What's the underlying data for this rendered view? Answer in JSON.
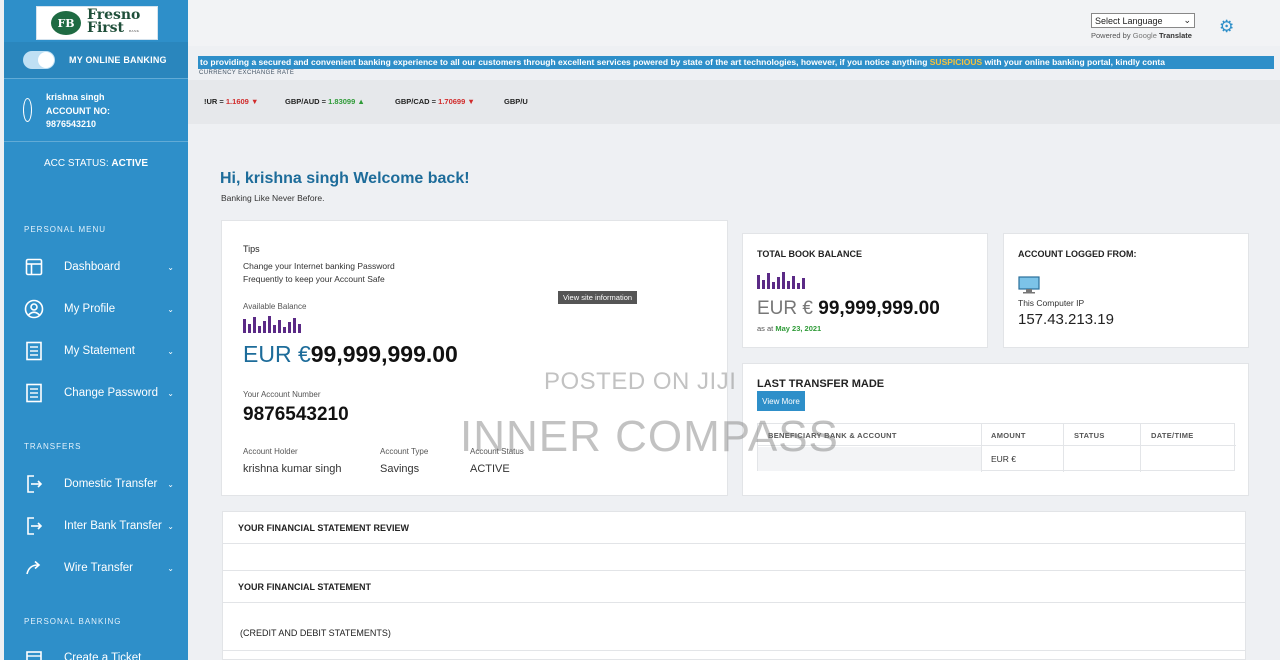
{
  "brand": {
    "logo_mark": "FB",
    "name_line1": "Fresno",
    "name_line2": "First",
    "name_tag": "BANK"
  },
  "sidebar": {
    "online_label": "MY ONLINE BANKING",
    "user_name": "krishna singh",
    "account_label": "ACCOUNT NO:",
    "account_number": "9876543210",
    "status_label": "ACC STATUS:",
    "status_value": "ACTIVE",
    "personal_menu_label": "PERSONAL MENU",
    "personal_items": [
      {
        "label": "Dashboard",
        "icon": "layout-icon"
      },
      {
        "label": "My Profile",
        "icon": "user-circle-icon"
      },
      {
        "label": "My Statement",
        "icon": "document-icon"
      },
      {
        "label": "Change Password",
        "icon": "document-icon"
      }
    ],
    "transfers_label": "TRANSFERS",
    "transfer_items": [
      {
        "label": "Domestic Transfer",
        "icon": "transfer-icon"
      },
      {
        "label": "Inter Bank Transfer",
        "icon": "transfer-icon"
      },
      {
        "label": "Wire Transfer",
        "icon": "share-arrow-icon"
      }
    ],
    "personal_banking_label": "PERSONAL BANKING",
    "banking_items": [
      {
        "label": "Create a Ticket",
        "icon": "ticket-icon"
      }
    ]
  },
  "topbar": {
    "language_select": "Select Language",
    "powered_by": "Powered by",
    "google": "Google",
    "translate": "Translate"
  },
  "ticker": {
    "text_before": "to providing a secured and convenient banking experience to all our customers through excellent services powered by state of the art technologies, however, if you notice anything ",
    "highlight": "SUSPICIOUS",
    "text_after": " with your online banking portal, kindly conta"
  },
  "rates": {
    "label": "CURRENCY EXCHANGE RATE",
    "items": [
      {
        "pair": "!UR =",
        "value": "1.1609",
        "direction": "down"
      },
      {
        "pair": "GBP/AUD =",
        "value": "1.83099",
        "direction": "up"
      },
      {
        "pair": "GBP/CAD =",
        "value": "1.70699",
        "direction": "down"
      },
      {
        "pair": "GBP/U",
        "value": "",
        "direction": ""
      }
    ]
  },
  "welcome": {
    "title": "Hi, krishna singh Welcome back!",
    "subtitle": "Banking Like Never Before."
  },
  "balance_card": {
    "tips_label": "Tips",
    "tip_line1": "Change your Internet banking Password",
    "tip_line2": "Frequently to keep your Account Safe",
    "available_label": "Available Balance",
    "currency": "EUR €",
    "amount": "99,999,999.00",
    "tooltip": "View site information",
    "account_number_label": "Your Account Number",
    "account_number": "9876543210",
    "holder_label": "Account Holder",
    "holder_value": "krishna kumar singh",
    "type_label": "Account Type",
    "type_value": "Savings",
    "status_label": "Account Status",
    "status_value": "ACTIVE"
  },
  "book_balance": {
    "title": "TOTAL BOOK BALANCE",
    "currency": "EUR €",
    "amount": "99,999,999.00",
    "as_at": "as at",
    "date": "May 23, 2021"
  },
  "logged_from": {
    "title": "ACCOUNT LOGGED FROM:",
    "label": "This Computer IP",
    "ip": "157.43.213.19"
  },
  "last_transfer": {
    "title": "LAST TRANSFER MADE",
    "button": "View More",
    "columns": [
      "BENEFICIARY BANK & ACCOUNT",
      "AMOUNT",
      "STATUS",
      "DATE/TIME"
    ],
    "row": [
      "",
      "EUR €",
      "",
      ""
    ]
  },
  "sections": {
    "review": "YOUR FINANCIAL STATEMENT REVIEW",
    "statement": "YOUR FINANCIAL STATEMENT",
    "credit_debit": "(CREDIT AND DEBIT STATEMENTS)"
  },
  "watermarks": {
    "line1": "POSTED ON JIJI",
    "line2": "INNER COMPASS"
  },
  "colors": {
    "primary": "#2e8fc9",
    "accent_dark": "#1d6c9a",
    "bar_purple": "#5b2a86",
    "suspicious": "#f6c33c",
    "date_green": "#2f9b38"
  }
}
